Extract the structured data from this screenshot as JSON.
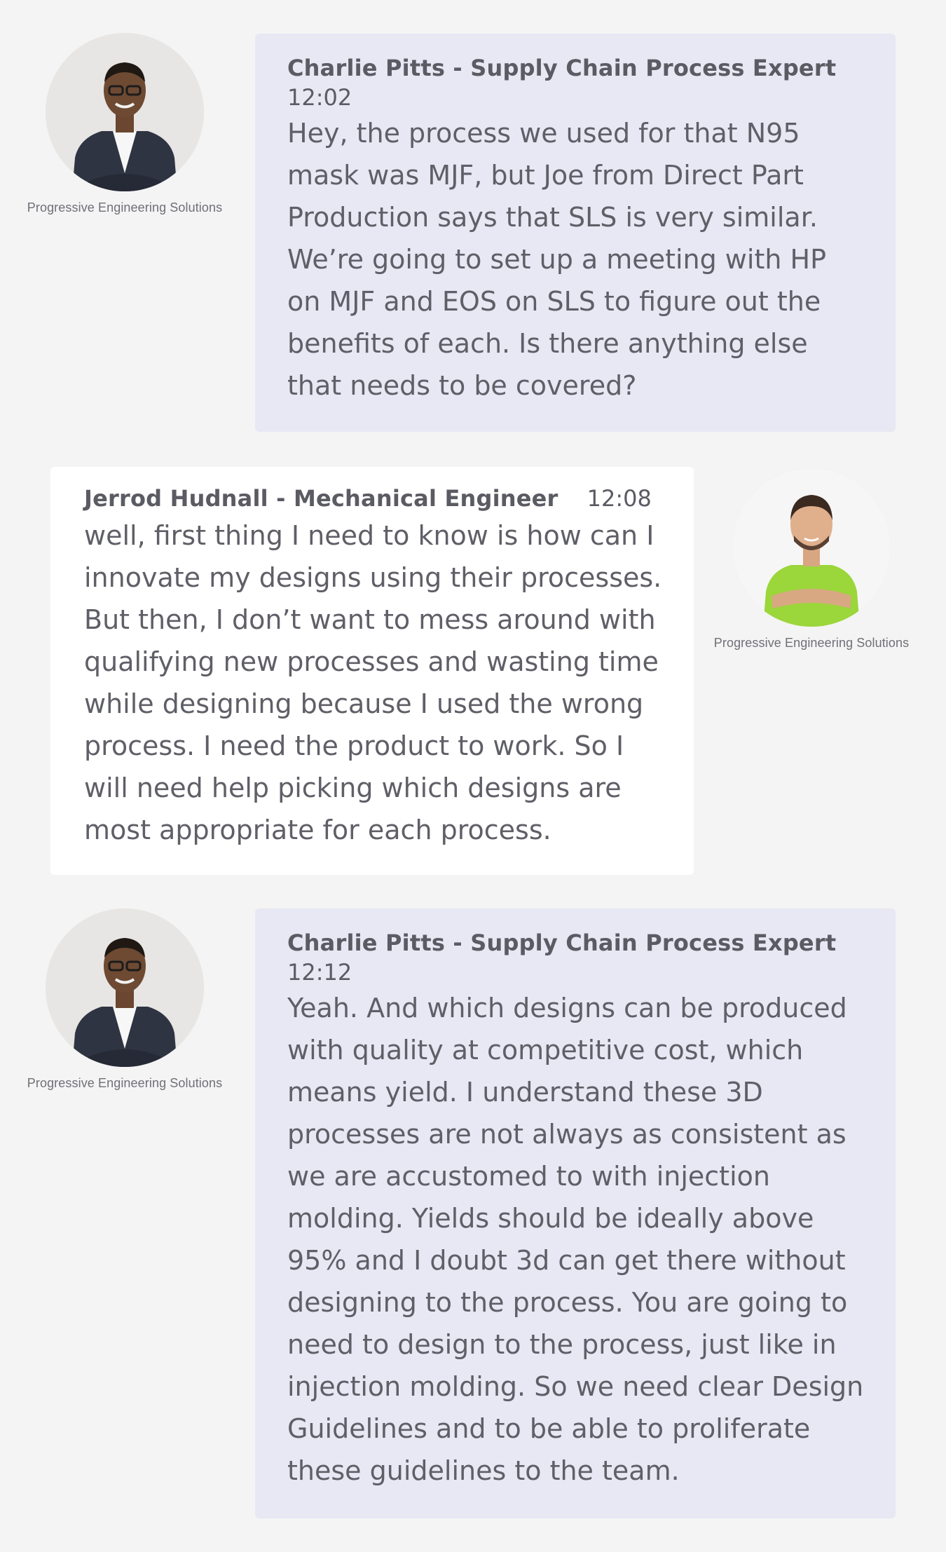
{
  "messages": [
    {
      "sender": "Charlie Pitts - Supply Chain Process Expert",
      "time": "12:02",
      "company": "Progressive Engineering Solutions",
      "avatar_icon": "person-avatar-icon",
      "text": "Hey, the process we used for that N95 mask was MJF, but Joe from Direct Part Production says that SLS is very similar. We’re going to set up a meeting with HP on MJF and EOS on SLS to figure out the benefits of each. Is there anything else that needs to be covered?"
    },
    {
      "sender": "Jerrod Hudnall - Mechanical Engineer",
      "time": "12:08",
      "company": "Progressive Engineering Solutions",
      "avatar_icon": "person-avatar-icon",
      "text": "well, first thing I need to know is how can I innovate my designs using their processes. But then, I don’t want to mess around with qualifying new processes and wasting time while designing because I used the wrong process. I need the product to work. So I will need help picking which designs are most appropriate for each process."
    },
    {
      "sender": "Charlie Pitts - Supply Chain Process Expert",
      "time": "12:12",
      "company": "Progressive Engineering Solutions",
      "avatar_icon": "person-avatar-icon",
      "text": "Yeah. And which designs can be produced with quality at competitive cost, which means yield. I understand these 3D processes are not always as consistent as we are accustomed to with injection molding. Yields should be ideally above 95% and I doubt 3d can get there without designing to the process. You are going to need to design to the process, just like in injection molding. So we need clear Design Guidelines and to be able to proliferate these guidelines to the team."
    }
  ],
  "colors": {
    "page_background": "#f4f4f4",
    "own_bubble": "#e8e7f4",
    "other_bubble": "#ffffff",
    "text": "#5f5f67"
  }
}
